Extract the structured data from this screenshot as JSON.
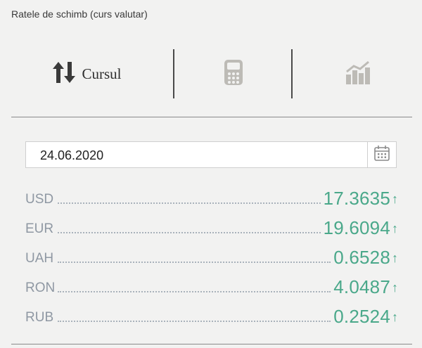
{
  "header": {
    "title": "Ratele de schimb (curs valutar)"
  },
  "tabs": [
    {
      "label": "Cursul",
      "icon": "sort-arrows-icon"
    },
    {
      "label": "",
      "icon": "calculator-icon"
    },
    {
      "label": "",
      "icon": "bar-chart-icon"
    }
  ],
  "date_field": {
    "value": "24.06.2020",
    "icon": "calendar-icon"
  },
  "rates": [
    {
      "code": "USD",
      "value": "17.3635",
      "trend": "↑"
    },
    {
      "code": "EUR",
      "value": "19.6094",
      "trend": "↑"
    },
    {
      "code": "UAH",
      "value": "0.6528",
      "trend": "↑"
    },
    {
      "code": "RON",
      "value": "4.0487",
      "trend": "↑"
    },
    {
      "code": "RUB",
      "value": "0.2524",
      "trend": "↑"
    }
  ],
  "colors": {
    "positive": "#4aa88a",
    "code": "#8f98a3",
    "icon_muted": "#bdbbb6",
    "background": "#f2f2f1"
  }
}
